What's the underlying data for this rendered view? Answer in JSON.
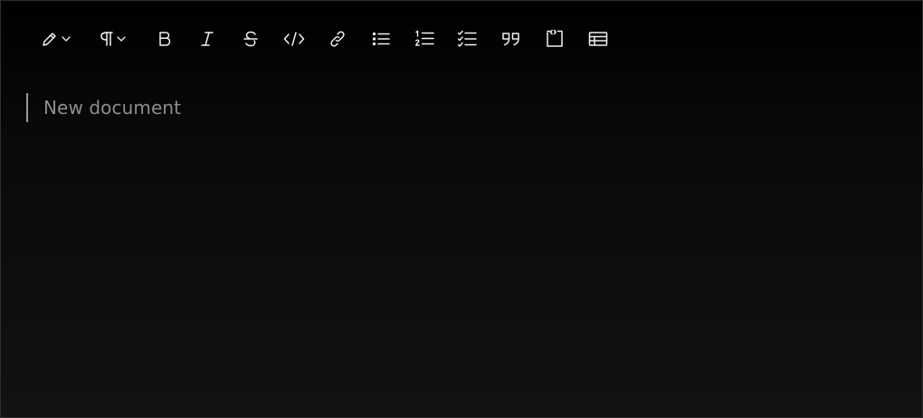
{
  "toolbar": {
    "items": [
      {
        "name": "highlight",
        "icon": "pencil-icon",
        "has_dropdown": true
      },
      {
        "name": "paragraph",
        "icon": "pilcrow-icon",
        "has_dropdown": true
      },
      {
        "name": "bold",
        "icon": "bold-icon",
        "glyph": "B"
      },
      {
        "name": "italic",
        "icon": "italic-icon",
        "glyph": "I"
      },
      {
        "name": "strikethrough",
        "icon": "strikethrough-icon",
        "glyph": "S"
      },
      {
        "name": "code",
        "icon": "code-icon",
        "glyph": "</>"
      },
      {
        "name": "link",
        "icon": "link-icon"
      },
      {
        "name": "bullet-list",
        "icon": "bullet-list-icon"
      },
      {
        "name": "ordered-list",
        "icon": "ordered-list-icon"
      },
      {
        "name": "task-list",
        "icon": "checklist-icon"
      },
      {
        "name": "blockquote",
        "icon": "quote-icon"
      },
      {
        "name": "code-block",
        "icon": "code-block-icon"
      },
      {
        "name": "table",
        "icon": "table-icon"
      }
    ]
  },
  "document": {
    "placeholder": "New document"
  },
  "colors": {
    "background_top": "#000000",
    "background_bottom": "#121212",
    "icon": "#f2f2f2",
    "placeholder": "#8d8d8d",
    "cursor": "#9a9a9a"
  }
}
